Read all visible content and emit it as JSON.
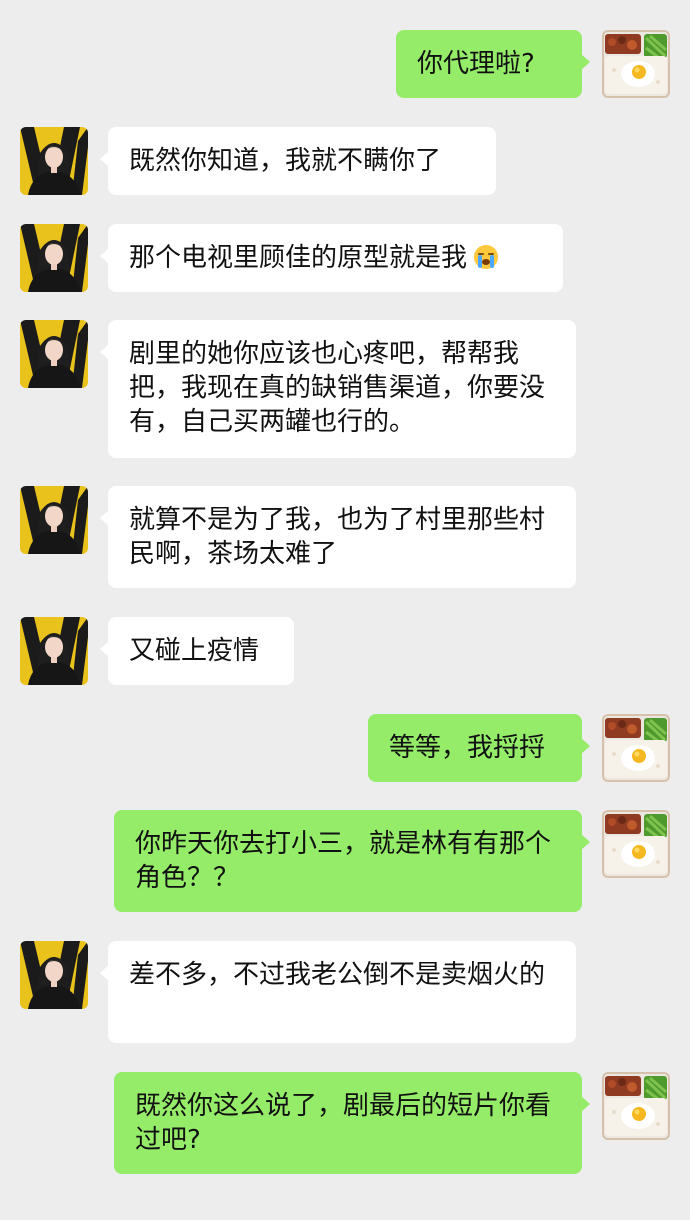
{
  "chat": {
    "messages": [
      {
        "side": "right",
        "avatar": "food-plate-avatar",
        "text": "你代理啦?"
      },
      {
        "side": "left",
        "avatar": "woman-portrait-avatar",
        "text": "既然你知道，我就不瞒你了"
      },
      {
        "side": "left",
        "avatar": "woman-portrait-avatar",
        "text": "那个电视里顾佳的原型就是我",
        "emoji": "crying-face-icon"
      },
      {
        "side": "left",
        "avatar": "woman-portrait-avatar",
        "text": "剧里的她你应该也心疼吧，帮帮我把，我现在真的缺销售渠道，你要没有，自己买两罐也行的。"
      },
      {
        "side": "left",
        "avatar": "woman-portrait-avatar",
        "text": "就算不是为了我，也为了村里那些村民啊，茶场太难了"
      },
      {
        "side": "left",
        "avatar": "woman-portrait-avatar",
        "text": "又碰上疫情"
      },
      {
        "side": "right",
        "avatar": "food-plate-avatar",
        "text": "等等，我捋捋"
      },
      {
        "side": "right",
        "avatar": "food-plate-avatar",
        "text": "你昨天你去打小三，就是林有有那个角色？？"
      },
      {
        "side": "left",
        "avatar": "woman-portrait-avatar",
        "text": "差不多，不过我老公倒不是卖烟火的"
      },
      {
        "side": "right",
        "avatar": "food-plate-avatar",
        "text": "既然你这么说了，剧最后的短片你看过吧?"
      }
    ]
  },
  "colors": {
    "background": "#ededed",
    "incoming_bubble": "#ffffff",
    "outgoing_bubble": "#95ec69",
    "text": "#111111"
  }
}
